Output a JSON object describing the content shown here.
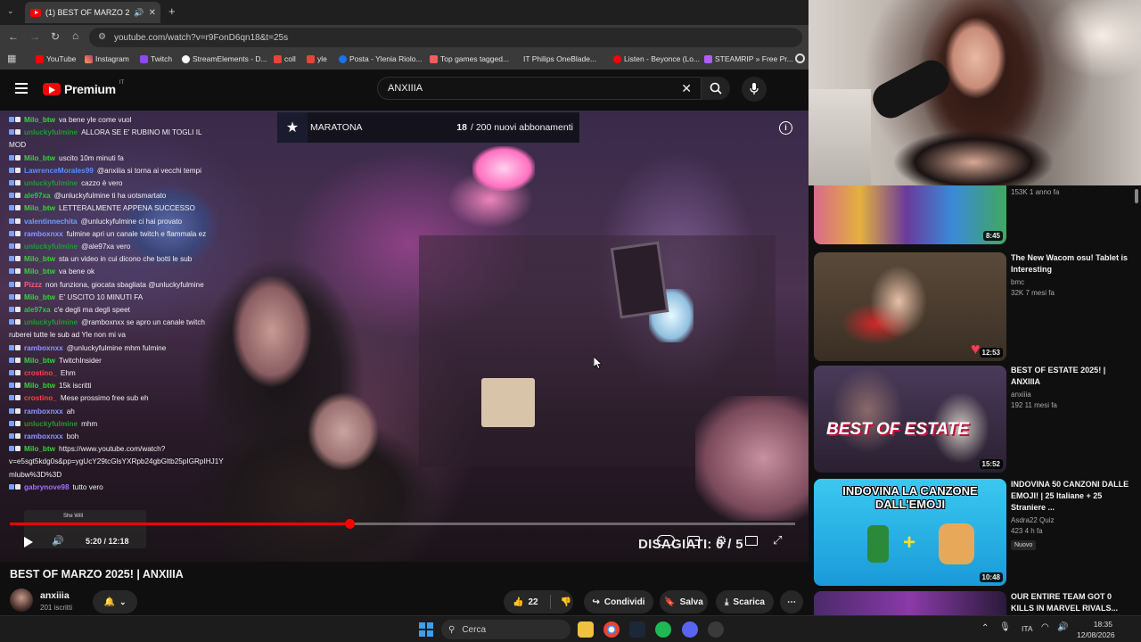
{
  "browser": {
    "tab_title": "(1) BEST OF MARZO 2025! | ANXIIIA",
    "url": "youtube.com/watch?v=r9FonD6qn18&t=25s",
    "bookmarks": [
      "YouTube",
      "Instagram",
      "Twitch",
      "StreamElements - D...",
      "coll",
      "yle",
      "Posta - Ylenia Riolo...",
      "Top games tagged...",
      "IT Philips OneBlade...",
      "Listen - Beyonce (Lo...",
      "STEAMRIP » Free Pr..."
    ]
  },
  "youtube": {
    "logo": "Premium",
    "logo_region": "IT",
    "search_value": "ANXIIIA"
  },
  "video": {
    "goal_label": "MARATONA",
    "goal_count": "18",
    "goal_text": "/ 200 nuovi abbonamenti",
    "time": "5:20 / 12:18",
    "progress": 0.433,
    "preview_label": "She Will",
    "overlay_text": "DISAGIATI: 0 / 5",
    "chat": [
      {
        "user": "Milo_btw",
        "color": "#3ad13a",
        "text": "va bene yle come vuol"
      },
      {
        "user": "unluckyfulmine",
        "color": "#1a9e2a",
        "text": "ALLORA SE E' RUBINO MI TOGLI IL"
      },
      {
        "user": "",
        "color": "#ffffff",
        "text": "MOD"
      },
      {
        "user": "Milo_btw",
        "color": "#3ad13a",
        "text": "uscito 10m minuti fa"
      },
      {
        "user": "LawrenceMorales99",
        "color": "#5b8cff",
        "text": "@anxiiia si torna ai vecchi tempi"
      },
      {
        "user": "unluckyfulmine",
        "color": "#1a9e2a",
        "text": "cazzo è vero"
      },
      {
        "user": "ale97xa",
        "color": "#28c94a",
        "text": "@unluckyfulmine ti ha uotsmartato"
      },
      {
        "user": "Milo_btw",
        "color": "#3ad13a",
        "text": "LETTERALMENTE APPENA SUCCESSO"
      },
      {
        "user": "valentinnechita",
        "color": "#6aa0ff",
        "text": "@unluckyfulmine ci hai provato"
      },
      {
        "user": "ramboxnxx",
        "color": "#8a9aff",
        "text": "fulmine apri un canale twitch e flammala ez"
      },
      {
        "user": "unluckyfulmine",
        "color": "#1a9e2a",
        "text": "@ale97xa vero"
      },
      {
        "user": "Milo_btw",
        "color": "#3ad13a",
        "text": "sta un video in cui dicono che botti le sub"
      },
      {
        "user": "Milo_btw",
        "color": "#3ad13a",
        "text": "va bene ok"
      },
      {
        "user": "Pizzz",
        "color": "#ff5a7a",
        "text": "non funziona, giocata sbagliata @unluckyfulmine"
      },
      {
        "user": "Milo_btw",
        "color": "#3ad13a",
        "text": "E' USCITO 10 MINUTI FA"
      },
      {
        "user": "ale97xa",
        "color": "#28c94a",
        "text": "c'e degli ma degli speet"
      },
      {
        "user": "",
        "color": "#ffffff",
        "text": ""
      },
      {
        "user": "unluckyfulmine",
        "color": "#1a9e2a",
        "text": "@ramboxnxx se apro un canale twitch"
      },
      {
        "user": "",
        "color": "#ffffff",
        "text": "ruberei tutte le sub ad Yle non mi va"
      },
      {
        "user": "ramboxnxx",
        "color": "#8a9aff",
        "text": "@unluckyfulmine mhm     fulmine"
      },
      {
        "user": "Milo_btw",
        "color": "#3ad13a",
        "text": "TwitchInsider"
      },
      {
        "user": "crostino_",
        "color": "#ff4040",
        "text": "Ehm"
      },
      {
        "user": "Milo_btw",
        "color": "#3ad13a",
        "text": "15k iscritti"
      },
      {
        "user": "crostino_",
        "color": "#ff4040",
        "text": "Mese prossimo free sub eh"
      },
      {
        "user": "ramboxnxx",
        "color": "#8a9aff",
        "text": "ah"
      },
      {
        "user": "unluckyfulmine",
        "color": "#1a9e2a",
        "text": "mhm"
      },
      {
        "user": "ramboxnxx",
        "color": "#8a9aff",
        "text": "boh"
      },
      {
        "user": "Milo_btw",
        "color": "#3ad13a",
        "text": "https://www.youtube.com/watch?"
      },
      {
        "user": "",
        "color": "#ffffff",
        "text": "v=e5sgt5kdg0s&pp=ygUcY29tcGlsYXRpb24gbGltb25pIGRpIHJ1Y"
      },
      {
        "user": "",
        "color": "#ffffff",
        "text": "mlubw%3D%3D"
      },
      {
        "user": "gabrynove98",
        "color": "#a070ff",
        "text": "tutto vero"
      }
    ]
  },
  "below": {
    "title": "BEST OF MARZO 2025! | ANXIIIA",
    "channel": "anxiiia",
    "subscribers": "201 iscritti",
    "likes": "22",
    "share": "Condividi",
    "save": "Salva",
    "download": "Scarica"
  },
  "sidebar": {
    "videos": [
      {
        "title": "",
        "channel": "",
        "stats": "153K  1 anno fa",
        "duration": "8:45"
      },
      {
        "title": "The New Wacom osu! Tablet is Interesting",
        "channel": "bmc",
        "stats": "32K  7 mesi fa",
        "duration": "12:53"
      },
      {
        "title": "BEST OF ESTATE 2025! | ANXIIIA",
        "channel": "anxiiia",
        "stats": "192  11 mesi fa",
        "duration": "15:52",
        "thumb_text": "BEST OF ESTATE"
      },
      {
        "title": "INDOVINA 50 CANZONI DALLE EMOJI! | 25 Italiane + 25 Straniere ...",
        "channel": "Asdra22 Quiz",
        "stats": "423  4 h fa",
        "badge": "Nuovo",
        "duration": "10:48",
        "thumb_text": "INDOVINA LA CANZONE DALL'EMOJI"
      },
      {
        "title": "OUR ENTIRE TEAM GOT 0 KILLS IN MARVEL RIVALS...",
        "channel": "",
        "stats": "",
        "duration": ""
      }
    ]
  },
  "taskbar": {
    "search": "Cerca",
    "lang": "ITA",
    "time": "18:35",
    "date": "12/08/2026"
  }
}
